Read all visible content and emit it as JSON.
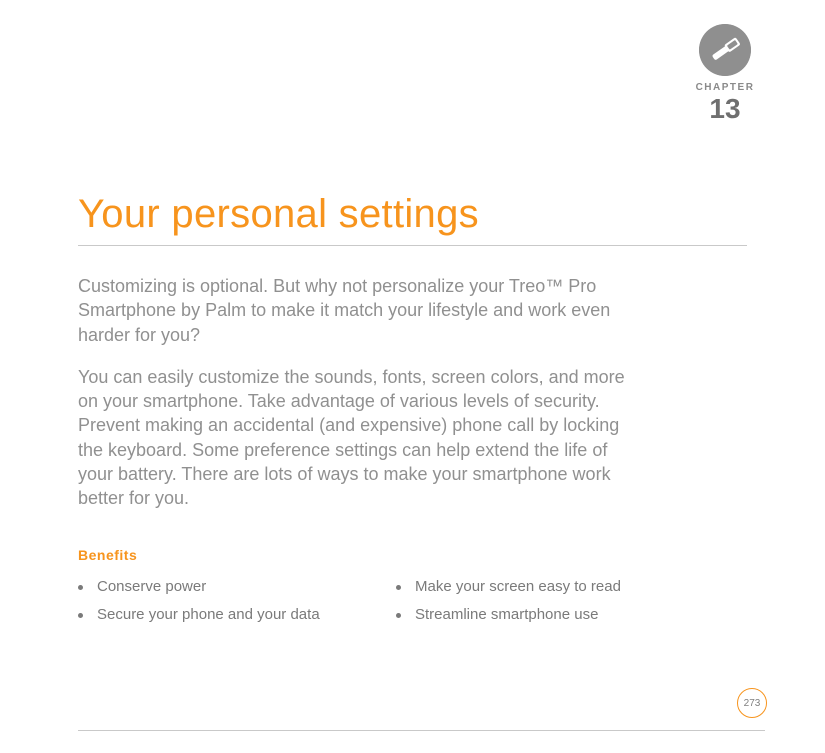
{
  "chapter": {
    "label": "CHAPTER",
    "number": "13",
    "icon_name": "tool-icon"
  },
  "title": "Your personal settings",
  "intro": {
    "p1": "Customizing is optional. But why not personalize your Treo™ Pro Smartphone by Palm to make it match your lifestyle and work even harder for you?",
    "p2": "You can easily customize the sounds, fonts, screen colors, and more on your smartphone. Take advantage of various levels of security. Prevent making an accidental (and expensive) phone call by locking the keyboard. Some preference settings can help extend the life of your battery. There are lots of ways to make your smartphone work better for you."
  },
  "benefits": {
    "heading": "Benefits",
    "col1": [
      "Conserve power",
      "Secure your phone and your data"
    ],
    "col2": [
      "Make your screen easy to read",
      "Streamline smartphone use"
    ]
  },
  "page_number": "273"
}
